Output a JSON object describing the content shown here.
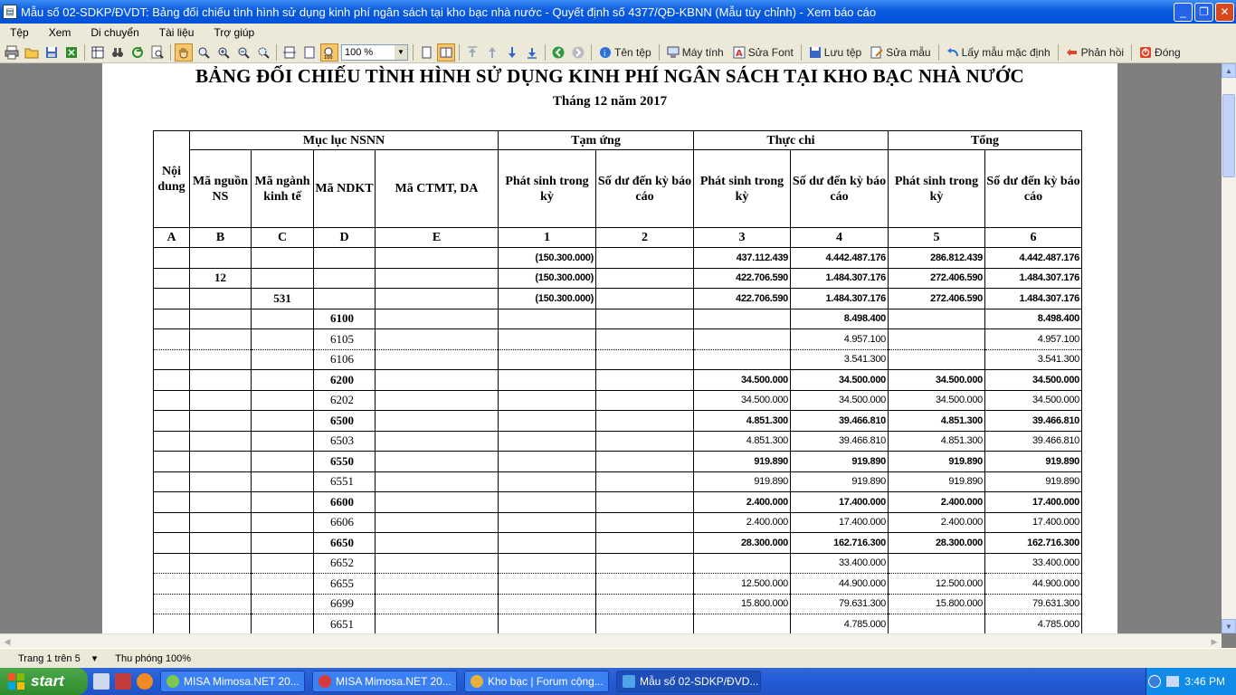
{
  "window": {
    "title": "Mẫu số 02-SDKP/ĐVDT: Bảng đối chiếu tình hình sử dụng kinh phí ngân sách tại kho bạc nhà nước - Quyết định số 4377/QĐ-KBNN (Mẫu tùy chỉnh) - Xem báo cáo"
  },
  "menu": [
    "Tệp",
    "Xem",
    "Di chuyển",
    "Tài liệu",
    "Trợ giúp"
  ],
  "toolbar": {
    "zoom_value": "100 %",
    "file_name": "Tên tệp",
    "computer": "Máy tính",
    "edit_font": "Sửa Font",
    "save_file": "Lưu tệp",
    "edit_template": "Sửa mẫu",
    "default_template": "Lấy mẫu mặc định",
    "feedback": "Phản hồi",
    "close": "Đóng"
  },
  "report": {
    "title": "BẢNG ĐỐI CHIẾU TÌNH HÌNH SỬ DỤNG KINH PHÍ NGÂN SÁCH TẠI KHO BẠC NHÀ NƯỚC",
    "subtitle": "Tháng 12 năm 2017",
    "headers": {
      "noi_dung": "Nội dung",
      "muc_luc": "Mục lục NSNN",
      "tam_ung": "Tạm ứng",
      "thuc_chi": "Thực chi",
      "tong": "Tổng",
      "ma_nguon": "Mã nguồn NS",
      "ma_nganh": "Mã ngành kinh tế",
      "ma_ndkt": "Mã NDKT",
      "ma_ctmt": "Mã CTMT, DA",
      "phat_sinh": "Phát sinh trong kỳ",
      "so_du": "Số dư đến kỳ báo cáo"
    },
    "col_codes": [
      "A",
      "B",
      "C",
      "D",
      "E",
      "1",
      "2",
      "3",
      "4",
      "5",
      "6"
    ],
    "rows": [
      {
        "bold": true,
        "dotted": false,
        "b": "",
        "c": "",
        "d": "",
        "v1": "(150.300.000)",
        "v2": "",
        "v3": "437.112.439",
        "v4": "4.442.487.176",
        "v5": "286.812.439",
        "v6": "4.442.487.176"
      },
      {
        "bold": true,
        "dotted": false,
        "b": "12",
        "c": "",
        "d": "",
        "v1": "(150.300.000)",
        "v2": "",
        "v3": "422.706.590",
        "v4": "1.484.307.176",
        "v5": "272.406.590",
        "v6": "1.484.307.176"
      },
      {
        "bold": true,
        "dotted": false,
        "b": "",
        "c": "531",
        "d": "",
        "v1": "(150.300.000)",
        "v2": "",
        "v3": "422.706.590",
        "v4": "1.484.307.176",
        "v5": "272.406.590",
        "v6": "1.484.307.176"
      },
      {
        "bold": true,
        "dotted": false,
        "b": "",
        "c": "",
        "d": "6100",
        "v1": "",
        "v2": "",
        "v3": "",
        "v4": "8.498.400",
        "v5": "",
        "v6": "8.498.400"
      },
      {
        "bold": false,
        "dotted": true,
        "b": "",
        "c": "",
        "d": "6105",
        "v1": "",
        "v2": "",
        "v3": "",
        "v4": "4.957.100",
        "v5": "",
        "v6": "4.957.100"
      },
      {
        "bold": false,
        "dotted": false,
        "b": "",
        "c": "",
        "d": "6106",
        "v1": "",
        "v2": "",
        "v3": "",
        "v4": "3.541.300",
        "v5": "",
        "v6": "3.541.300"
      },
      {
        "bold": true,
        "dotted": false,
        "b": "",
        "c": "",
        "d": "6200",
        "v1": "",
        "v2": "",
        "v3": "34.500.000",
        "v4": "34.500.000",
        "v5": "34.500.000",
        "v6": "34.500.000"
      },
      {
        "bold": false,
        "dotted": false,
        "b": "",
        "c": "",
        "d": "6202",
        "v1": "",
        "v2": "",
        "v3": "34.500.000",
        "v4": "34.500.000",
        "v5": "34.500.000",
        "v6": "34.500.000"
      },
      {
        "bold": true,
        "dotted": false,
        "b": "",
        "c": "",
        "d": "6500",
        "v1": "",
        "v2": "",
        "v3": "4.851.300",
        "v4": "39.466.810",
        "v5": "4.851.300",
        "v6": "39.466.810"
      },
      {
        "bold": false,
        "dotted": false,
        "b": "",
        "c": "",
        "d": "6503",
        "v1": "",
        "v2": "",
        "v3": "4.851.300",
        "v4": "39.466.810",
        "v5": "4.851.300",
        "v6": "39.466.810"
      },
      {
        "bold": true,
        "dotted": false,
        "b": "",
        "c": "",
        "d": "6550",
        "v1": "",
        "v2": "",
        "v3": "919.890",
        "v4": "919.890",
        "v5": "919.890",
        "v6": "919.890"
      },
      {
        "bold": false,
        "dotted": false,
        "b": "",
        "c": "",
        "d": "6551",
        "v1": "",
        "v2": "",
        "v3": "919.890",
        "v4": "919.890",
        "v5": "919.890",
        "v6": "919.890"
      },
      {
        "bold": true,
        "dotted": false,
        "b": "",
        "c": "",
        "d": "6600",
        "v1": "",
        "v2": "",
        "v3": "2.400.000",
        "v4": "17.400.000",
        "v5": "2.400.000",
        "v6": "17.400.000"
      },
      {
        "bold": false,
        "dotted": false,
        "b": "",
        "c": "",
        "d": "6606",
        "v1": "",
        "v2": "",
        "v3": "2.400.000",
        "v4": "17.400.000",
        "v5": "2.400.000",
        "v6": "17.400.000"
      },
      {
        "bold": true,
        "dotted": false,
        "b": "",
        "c": "",
        "d": "6650",
        "v1": "",
        "v2": "",
        "v3": "28.300.000",
        "v4": "162.716.300",
        "v5": "28.300.000",
        "v6": "162.716.300"
      },
      {
        "bold": false,
        "dotted": true,
        "b": "",
        "c": "",
        "d": "6652",
        "v1": "",
        "v2": "",
        "v3": "",
        "v4": "33.400.000",
        "v5": "",
        "v6": "33.400.000"
      },
      {
        "bold": false,
        "dotted": true,
        "b": "",
        "c": "",
        "d": "6655",
        "v1": "",
        "v2": "",
        "v3": "12.500.000",
        "v4": "44.900.000",
        "v5": "12.500.000",
        "v6": "44.900.000"
      },
      {
        "bold": false,
        "dotted": true,
        "b": "",
        "c": "",
        "d": "6699",
        "v1": "",
        "v2": "",
        "v3": "15.800.000",
        "v4": "79.631.300",
        "v5": "15.800.000",
        "v6": "79.631.300"
      },
      {
        "bold": false,
        "dotted": false,
        "b": "",
        "c": "",
        "d": "6651",
        "v1": "",
        "v2": "",
        "v3": "",
        "v4": "4.785.000",
        "v5": "",
        "v6": "4.785.000"
      }
    ]
  },
  "status": {
    "page": "Trang 1 trên 5",
    "zoom": "Thu phóng 100%"
  },
  "taskbar": {
    "start": "start",
    "tasks": [
      "MISA Mimosa.NET 20...",
      "MISA Mimosa.NET 20...",
      "Kho bạc | Forum cộng...",
      "Mẫu số 02-SDKP/ĐVD..."
    ],
    "clock": "3:46 PM"
  },
  "colors": {
    "titlebar": "#0a5be0",
    "chrome": "#ece9d8",
    "viewport_bg": "#7f7f7f",
    "taskbar": "#245dda",
    "start_green": "#3a9a3a"
  }
}
